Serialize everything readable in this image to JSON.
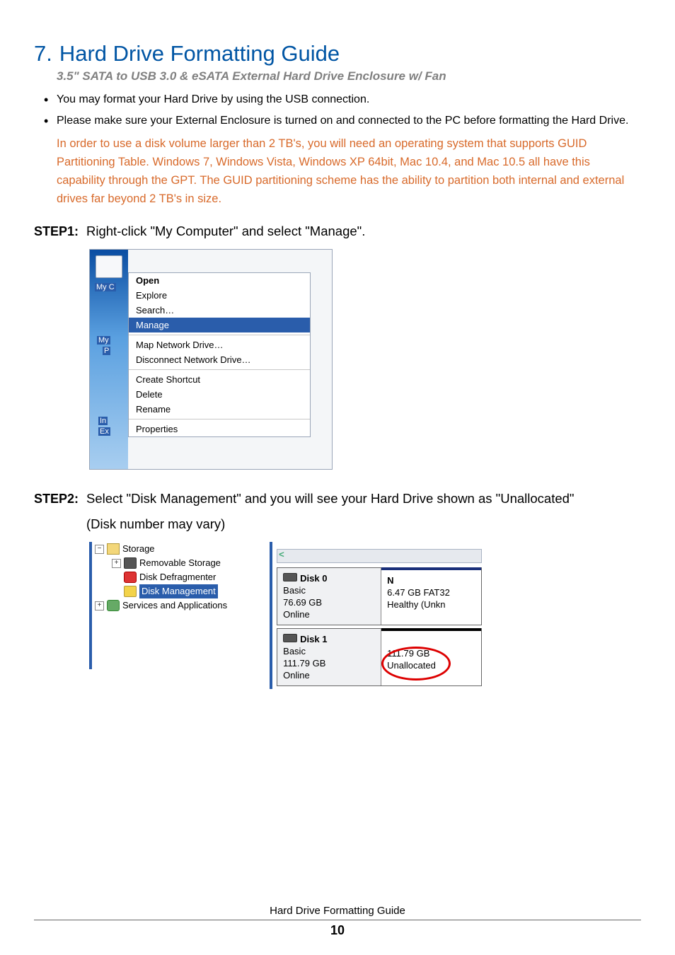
{
  "section": {
    "number": "7.",
    "title": "Hard Drive Formatting Guide",
    "product": "3.5\" SATA to USB 3.0 & eSATA External Hard Drive Enclosure w/ Fan"
  },
  "bullets": [
    "You may format your Hard Drive by using the USB connection.",
    "Please make sure your External Enclosure is turned on and connected to the PC before formatting the Hard Drive."
  ],
  "note": "In order to use a disk volume larger than 2 TB's, you will need an operating system that supports GUID Partitioning Table.  Windows 7, Windows Vista, Windows XP 64bit, Mac 10.4, and Mac 10.5 all have this capability through the GPT. The GUID partitioning scheme has the ability to partition both internal and external drives far beyond 2 TB's in size.",
  "step1": {
    "label": "STEP1:",
    "text": "Right-click \"My Computer\" and select \"Manage\"."
  },
  "step2": {
    "label": "STEP2:",
    "line1": "Select \"Disk Management\" and you will see your Hard Drive shown as \"Unallocated\"",
    "line2": "(Disk number may vary)"
  },
  "ss1": {
    "iconLabel": "My C",
    "sideLabel1": "My",
    "sideLabel2": "P",
    "sideLabel3": "In",
    "sideLabel4": "Ex",
    "menu": {
      "open": "Open",
      "explore": "Explore",
      "search": "Search…",
      "manage": "Manage",
      "mapDrive": "Map Network Drive…",
      "disconnectDrive": "Disconnect Network Drive…",
      "createShortcut": "Create Shortcut",
      "delete": "Delete",
      "rename": "Rename",
      "properties": "Properties"
    }
  },
  "ss2": {
    "tree": {
      "storage": "Storage",
      "removable": "Removable Storage",
      "defrag": "Disk Defragmenter",
      "diskMgmt": "Disk Management",
      "services": "Services and Applications"
    },
    "disk0": {
      "title": "Disk 0",
      "type": "Basic",
      "size": "76.69 GB",
      "status": "Online",
      "volLetter": "N",
      "volSize": "6.47 GB FAT32",
      "volStatus": "Healthy (Unkn"
    },
    "disk1": {
      "title": "Disk 1",
      "type": "Basic",
      "size": "111.79 GB",
      "status": "Online",
      "volSize": "111.79 GB",
      "volStatus": "Unallocated"
    }
  },
  "footer": {
    "title": "Hard Drive Formatting Guide",
    "page": "10"
  }
}
